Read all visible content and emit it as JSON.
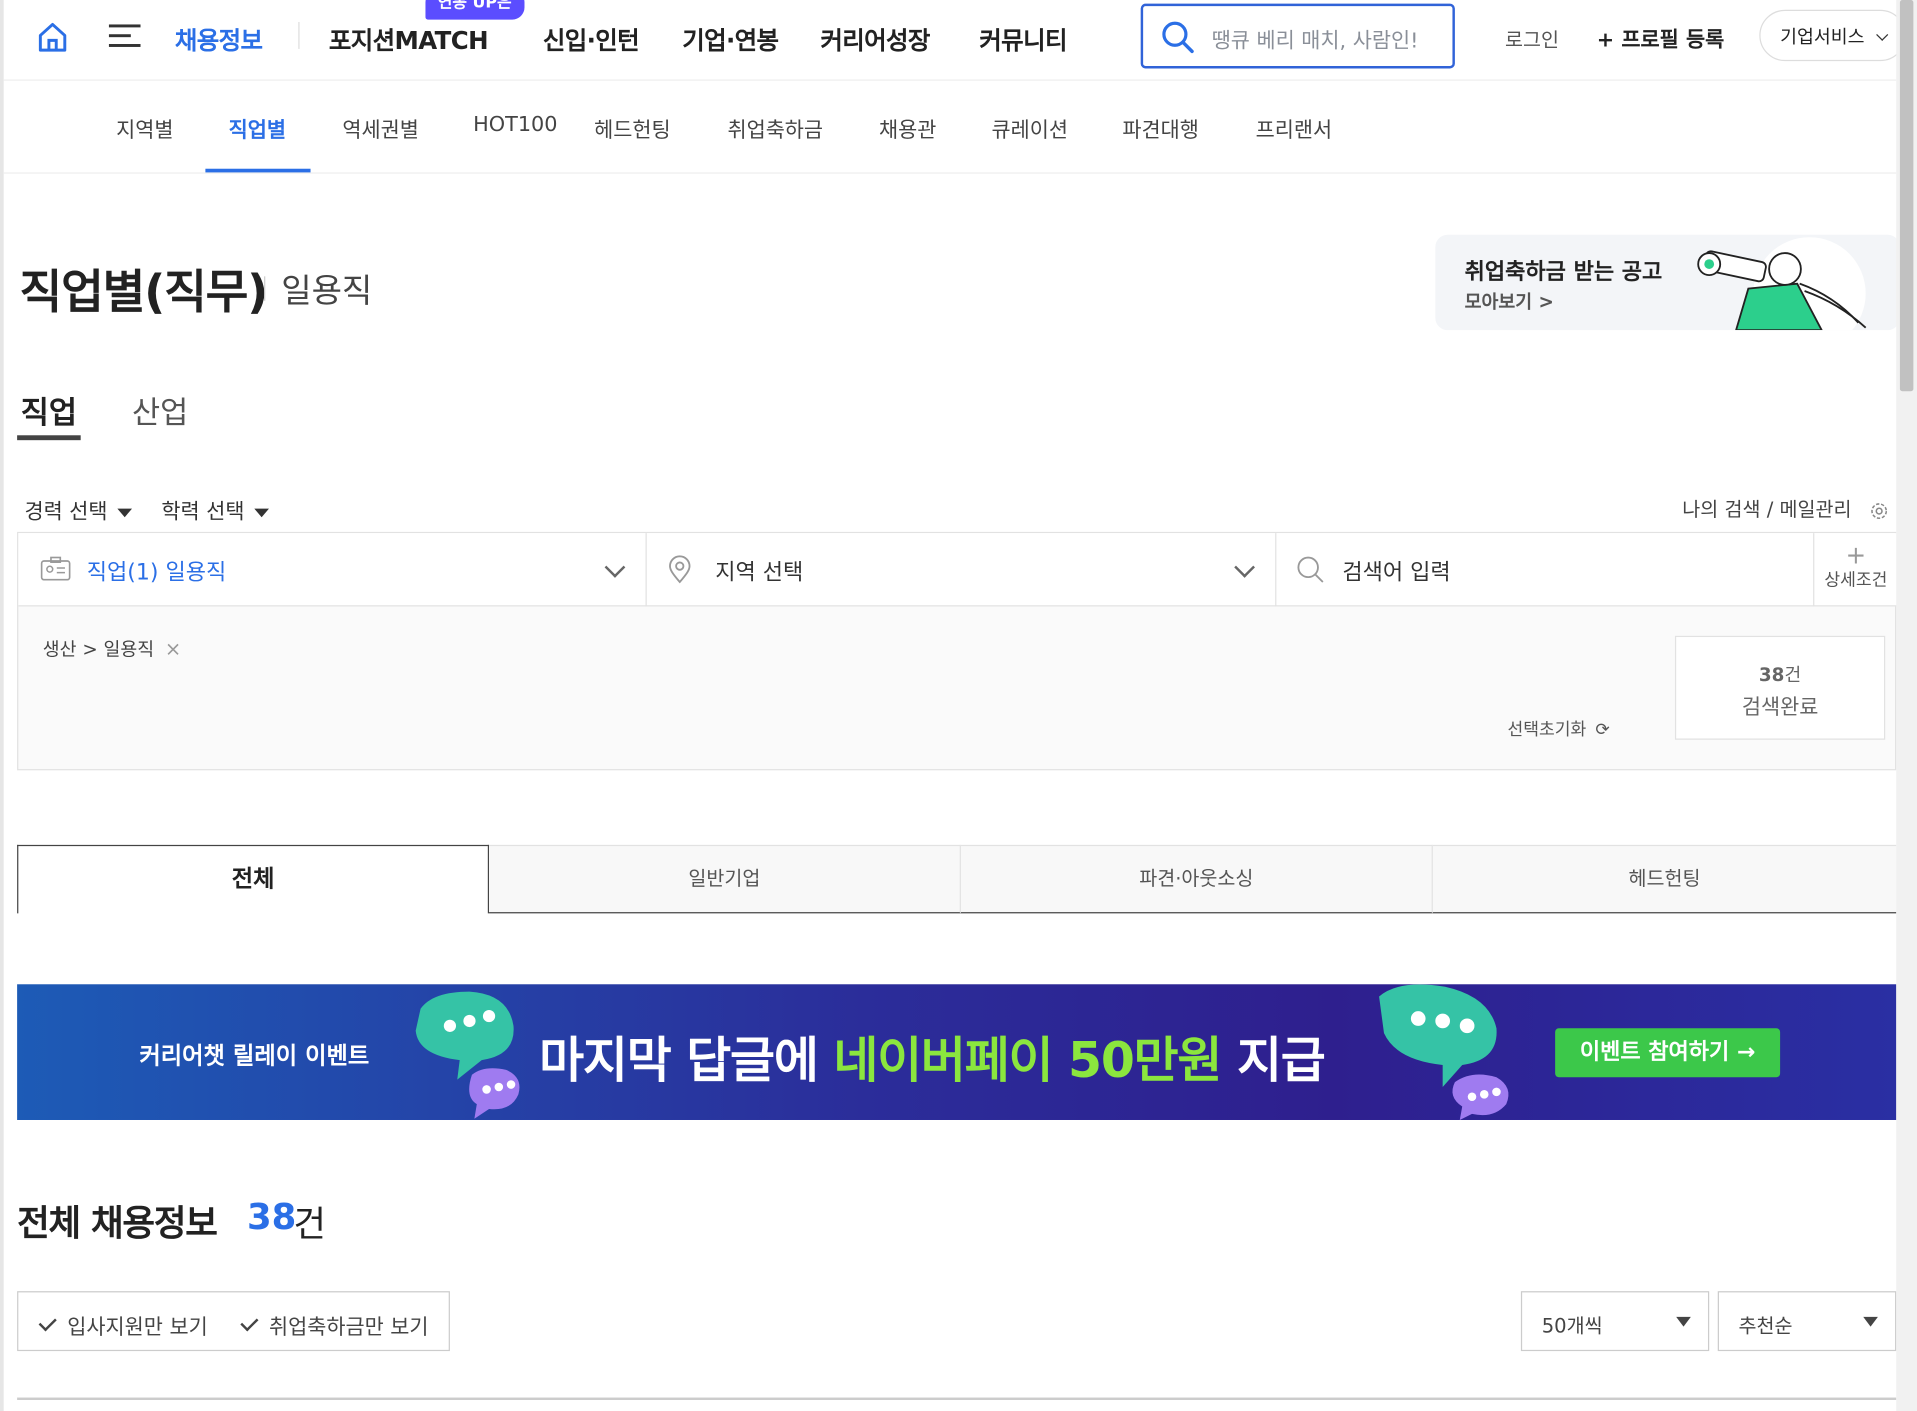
{
  "gnb": {
    "nav": [
      "채용정보",
      "포지션MATCH",
      "신입·인턴",
      "기업·연봉",
      "커리어성장",
      "커뮤니티"
    ],
    "match_badge": "연봉 UP은",
    "search_placeholder": "땡큐 베리 매치, 사람인!",
    "login": "로그인",
    "profile": "+ 프로필 등록",
    "biz": "기업서비스"
  },
  "subnav": [
    "지역별",
    "직업별",
    "역세권별",
    "HOT100",
    "헤드헌팅",
    "취업축하금",
    "채용관",
    "큐레이션",
    "파견대행",
    "프리랜서"
  ],
  "page": {
    "title": "직업별(직무)",
    "subtitle": "일용직"
  },
  "promo": {
    "line1": "취업축하금 받는 공고",
    "line2": "모아보기 >"
  },
  "job_tabs": [
    "직업",
    "산업"
  ],
  "filters": {
    "career": "경력 선택",
    "education": "학력 선택",
    "my_search": "나의 검색 / 메일관리"
  },
  "search_box": {
    "job": "직업(1) 일용직",
    "region": "지역 선택",
    "keyword_placeholder": "검색어 입력",
    "detail": "상세조건",
    "chip": "생산 > 일용직",
    "reset": "선택초기화",
    "count": "38",
    "count_unit": "건",
    "count_label": "검색완료"
  },
  "segments": [
    "전체",
    "일반기업",
    "파견·아웃소싱",
    "헤드헌팅"
  ],
  "banner": {
    "left": "커리어챗 릴레이 이벤트",
    "main_a": "마지막 답글에 ",
    "main_b": "네이버페이 50만원",
    "main_c": " 지급",
    "cta": "이벤트 참여하기 →"
  },
  "results": {
    "title": "전체 채용정보",
    "count": "38",
    "unit": "건",
    "check1": "입사지원만 보기",
    "check2": "취업축하금만 보기",
    "per_page": "50개씩",
    "sort": "추천순"
  },
  "colors": {
    "accent": "#2b6fe6",
    "banner_green": "#8be63e",
    "cta_green": "#3cc84a"
  }
}
